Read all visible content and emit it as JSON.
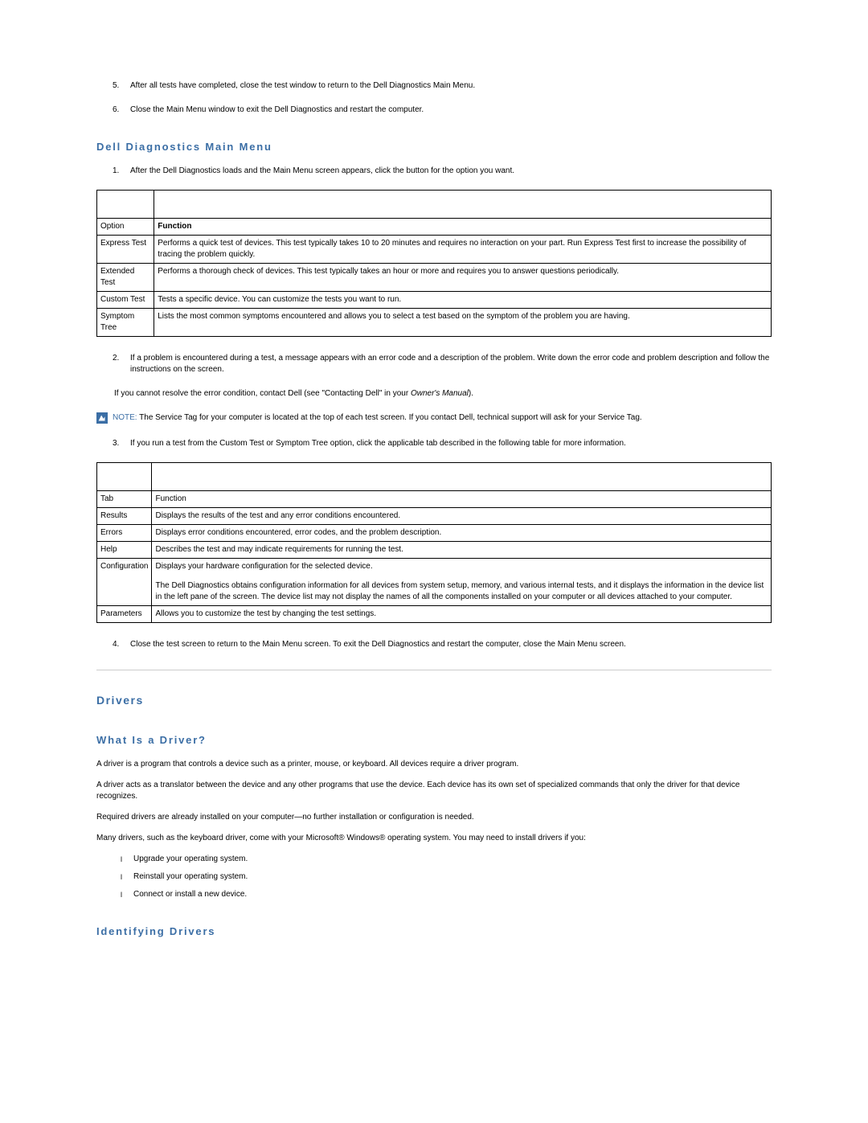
{
  "intro_list": [
    {
      "num": "5.",
      "text": "After all tests have completed, close the test window to return to the Dell Diagnostics Main Menu."
    },
    {
      "num": "6.",
      "text": "Close the Main Menu window to exit the Dell Diagnostics and restart the computer."
    }
  ],
  "heading_main_menu": "Dell Diagnostics Main Menu",
  "step1": {
    "num": "1.",
    "text": "After the Dell Diagnostics loads and the Main Menu screen appears, click the button for the option you want."
  },
  "table1_headers": {
    "col1": "Option",
    "col2": "Function"
  },
  "table1_rows": [
    {
      "c1": "Express Test",
      "c2": "Performs a quick test of devices. This test typically takes 10 to 20 minutes and requires no interaction on your part. Run Express Test first to increase the possibility of tracing the problem quickly."
    },
    {
      "c1": "Extended Test",
      "c2": "Performs a thorough check of devices. This test typically takes an hour or more and requires you to answer questions periodically."
    },
    {
      "c1": "Custom Test",
      "c2": "Tests a specific device. You can customize the tests you want to run."
    },
    {
      "c1": "Symptom Tree",
      "c2": "Lists the most common symptoms encountered and allows you to select a test based on the symptom of the problem you are having."
    }
  ],
  "step2": {
    "num": "2.",
    "text": "If a problem is encountered during a test, a message appears with an error code and a description of the problem. Write down the error code and problem description and follow the instructions on the screen."
  },
  "step2b_prefix": "If you cannot resolve the error condition, contact Dell (see \"Contacting Dell\" in your ",
  "step2b_italic": "Owner's Manual",
  "step2b_suffix": ").",
  "note_label": "NOTE:",
  "note_text": " The Service Tag for your computer is located at the top of each test screen. If you contact Dell, technical support will ask for your Service Tag.",
  "step3": {
    "num": "3.",
    "text": "If you run a test from the Custom Test or Symptom Tree option, click the applicable tab described in the following table for more information."
  },
  "table2_headers": {
    "col1": "Tab",
    "col2": "Function"
  },
  "table2_rows": [
    {
      "c1": "Results",
      "c2": "Displays the results of the test and any error conditions encountered."
    },
    {
      "c1": "Errors",
      "c2": "Displays error conditions encountered, error codes, and the problem description."
    },
    {
      "c1": "Help",
      "c2": "Describes the test and may indicate requirements for running the test."
    },
    {
      "c1": "Configuration",
      "c2_p1": "Displays your hardware configuration for the selected device.",
      "c2_p2": "The Dell Diagnostics obtains configuration information for all devices from system setup, memory, and various internal tests, and it displays the information in the device list in the left pane of the screen. The device list may not display the names of all the components installed on your computer or all devices attached to your computer."
    },
    {
      "c1": "Parameters",
      "c2": "Allows you to customize the test by changing the test settings."
    }
  ],
  "step4": {
    "num": "4.",
    "text": "Close the test screen to return to the Main Menu screen. To exit the Dell Diagnostics and restart the computer, close the Main Menu screen."
  },
  "heading_drivers": "Drivers",
  "heading_what_driver": "What Is a Driver?",
  "drivers_p1": "A driver is a program that controls a device such as a printer, mouse, or keyboard. All devices require a driver program.",
  "drivers_p2": "A driver acts as a translator between the device and any other programs that use the device. Each device has its own set of specialized commands that only the driver for that device recognizes.",
  "drivers_p3": "Required drivers are already installed on your computer—no further installation or configuration is needed.",
  "drivers_p4": "Many drivers, such as the keyboard driver, come with your Microsoft® Windows® operating system. You may need to install drivers if you:",
  "driver_bullets": [
    "Upgrade your operating system.",
    "Reinstall your operating system.",
    "Connect or install a new device."
  ],
  "heading_identifying": "Identifying Drivers"
}
